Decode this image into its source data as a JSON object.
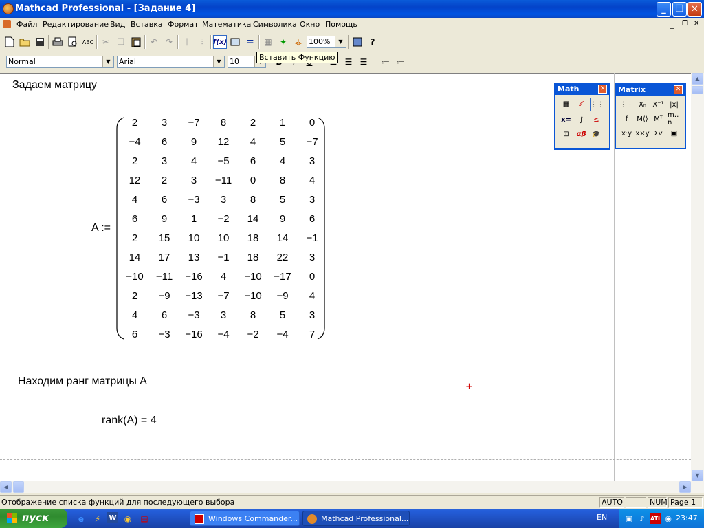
{
  "window": {
    "title": "Mathcad Professional - [Задание 4]",
    "controls": {
      "minimize": "_",
      "maximize": "❐",
      "close": "✕"
    }
  },
  "menu": [
    "Файл",
    "Редактирование",
    "Вид",
    "Вставка",
    "Формат",
    "Математика",
    "Символика",
    "Окно",
    "Помощь"
  ],
  "toolbar": {
    "zoom": "100%",
    "tooltip": "Вставить Функцию",
    "fx_label": "f(x)"
  },
  "format_bar": {
    "style": "Normal",
    "font": "Arial",
    "size": "10"
  },
  "document": {
    "heading1": "Задаем матрицу",
    "matrix_name": "A :=",
    "matrix": [
      [
        "2",
        "3",
        "−7",
        "8",
        "2",
        "1",
        "0"
      ],
      [
        "−4",
        "6",
        "9",
        "12",
        "4",
        "5",
        "−7"
      ],
      [
        "2",
        "3",
        "4",
        "−5",
        "6",
        "4",
        "3"
      ],
      [
        "12",
        "2",
        "3",
        "−11",
        "0",
        "8",
        "4"
      ],
      [
        "4",
        "6",
        "−3",
        "3",
        "8",
        "5",
        "3"
      ],
      [
        "6",
        "9",
        "1",
        "−2",
        "14",
        "9",
        "6"
      ],
      [
        "2",
        "15",
        "10",
        "10",
        "18",
        "14",
        "−1"
      ],
      [
        "14",
        "17",
        "13",
        "−1",
        "18",
        "22",
        "3"
      ],
      [
        "−10",
        "−11",
        "−16",
        "4",
        "−10",
        "−17",
        "0"
      ],
      [
        "2",
        "−9",
        "−13",
        "−7",
        "−10",
        "−9",
        "4"
      ],
      [
        "4",
        "6",
        "−3",
        "3",
        "8",
        "5",
        "3"
      ],
      [
        "6",
        "−3",
        "−16",
        "−4",
        "−2",
        "−4",
        "7"
      ]
    ],
    "heading2": "Находим ранг матрицы А",
    "result": "rank(A) = 4"
  },
  "palettes": {
    "math": {
      "title": "Math"
    },
    "matrix": {
      "title": "Matrix"
    }
  },
  "status": {
    "message": "Отображение списка функций для последующего выбора",
    "auto": "AUTO",
    "num": "NUM",
    "page": "Page 1"
  },
  "taskbar": {
    "start": "пуск",
    "tasks": [
      "Windows Commander...",
      "Mathcad Professional..."
    ],
    "lang": "EN",
    "clock": "23:47"
  }
}
